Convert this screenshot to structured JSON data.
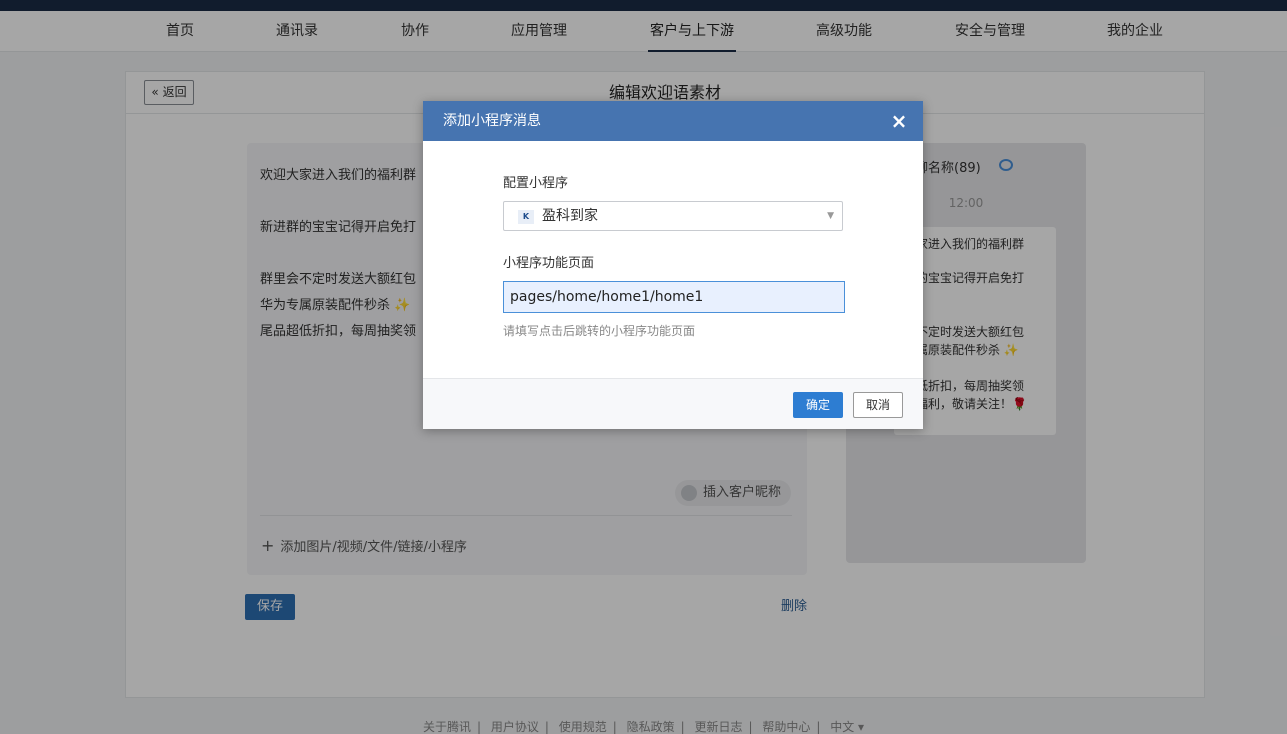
{
  "nav": {
    "items": [
      "首页",
      "通讯录",
      "协作",
      "应用管理",
      "客户与上下游",
      "高级功能",
      "安全与管理",
      "我的企业"
    ],
    "active": "客户与上下游"
  },
  "page": {
    "back_label": "« 返回",
    "title": "编辑欢迎语素材"
  },
  "editor": {
    "lines": [
      "欢迎大家进入我们的福利群",
      "新进群的宝宝记得开启免打",
      "群里会不定时发送大额红包",
      "华为专属原装配件秒杀 ✨",
      "尾品超低折扣，每周抽奖领"
    ],
    "insert_nickname": "插入客户昵称",
    "add_media": "添加图片/视频/文件/链接/小程序"
  },
  "preview": {
    "title": "群聊名称(89)",
    "time": "12:00",
    "lines": [
      "大家进入我们的福利群",
      "群的宝宝记得开启免打",
      "✌",
      "会不定时发送大额红包",
      "专属原装配件秒杀 ✨",
      "✨",
      "超低折扣，每周抽奖领",
      "等福利，敬请关注！🌹"
    ]
  },
  "actions": {
    "save": "保存",
    "delete": "删除"
  },
  "footer": [
    "关于腾讯",
    "用户协议",
    "使用规范",
    "隐私政策",
    "更新日志",
    "帮助中心",
    "中文 ▾"
  ],
  "dialog": {
    "title": "添加小程序消息",
    "close_icon": "×",
    "config_label": "配置小程序",
    "selected_app": "盈科到家",
    "app_logo_text": "K",
    "page_label": "小程序功能页面",
    "page_value": "pages/home/home1/home1",
    "hint": "请填写点击后跳转的小程序功能页面",
    "ok": "确定",
    "cancel": "取消"
  },
  "colors": {
    "accent": "#4674b0",
    "primary_button": "#2d7dd2",
    "topbar": "#1b2c45"
  }
}
